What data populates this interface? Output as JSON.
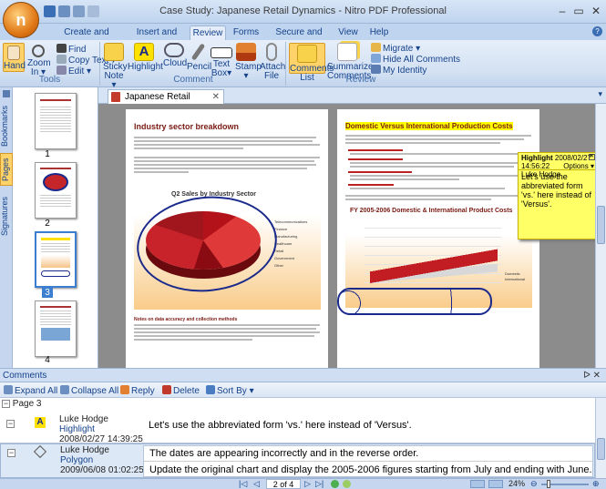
{
  "app": {
    "title": "Case Study: Japanese Retail Dynamics - Nitro PDF Professional",
    "button_letter": "n"
  },
  "window": {
    "minimize": "–",
    "maximize": "▭",
    "close": "✕"
  },
  "tabs": [
    {
      "label": "Create and Convert"
    },
    {
      "label": "Insert and Edit"
    },
    {
      "label": "Review"
    },
    {
      "label": "Forms"
    },
    {
      "label": "Secure and Sign"
    },
    {
      "label": "View"
    },
    {
      "label": "Help"
    }
  ],
  "ribbon": {
    "tools": {
      "group": "Tools",
      "hand": "Hand",
      "zoom": "Zoom",
      "zoom2": "In ▾",
      "find": "Find",
      "copy_text": "Copy Text ▾",
      "edit": "Edit ▾"
    },
    "comment": {
      "group": "Comment",
      "sticky": "Sticky",
      "sticky2": "Note ▾",
      "highlight": "Highlight",
      "cloud": "Cloud",
      "pencil": "Pencil",
      "text": "Text",
      "text2": "Box▾",
      "stamp": "Stamp",
      "stamp2": "▾",
      "attach": "Attach",
      "attach2": "File"
    },
    "review": {
      "group": "Review",
      "comments": "Comments",
      "comments2": "List",
      "summarize": "Summarize",
      "summarize2": "Comments",
      "migrate": "Migrate ▾",
      "hide_all": "Hide All Comments",
      "my_identity": "My Identity"
    }
  },
  "sidebar": {
    "bookmarks": "Bookmarks",
    "pages": "Pages",
    "signatures": "Signatures",
    "page_numbers": [
      "1",
      "2",
      "3",
      "4"
    ]
  },
  "doc_tab": {
    "label": "Japanese Retail Dynamics",
    "close": "✕"
  },
  "page_left": {
    "title": "Industry sector breakdown",
    "chart_title": "Q2 Sales by Industry Sector",
    "legend": [
      "Telecommunications",
      "Finance",
      "Manufacturing",
      "Healthcare",
      "Retail",
      "Government",
      "Other"
    ],
    "notes_title": "Notes on data accuracy and collection methods"
  },
  "page_right": {
    "title": "Domestic Versus International Production Costs",
    "chart_title": "FY 2005-2006 Domestic & International Product Costs",
    "legend": [
      "Domestic",
      "International"
    ]
  },
  "sticky_note": {
    "title": "Highlight",
    "date": "2008/02/27 14:56:22",
    "author": "Luke Hodge",
    "options": "Options ▾",
    "text": "Let's use the abbreviated form 'vs.' here instead of 'Versus'."
  },
  "comments": {
    "header": "Comments",
    "toolbar": {
      "expand_all": "Expand All",
      "collapse_all": "Collapse All",
      "reply": "Reply",
      "delete": "Delete",
      "sort_by": "Sort By ▾"
    },
    "page_group": "Page 3",
    "items": [
      {
        "author": "Luke Hodge",
        "type": "Highlight",
        "date": "2008/02/27 14:39:25",
        "text": "Let's use the abbreviated form 'vs.' here instead of 'Versus'."
      },
      {
        "author": "Luke Hodge",
        "type": "Polygon",
        "date": "2009/06/08 01:02:25",
        "text": "The dates are appearing incorrectly and in the reverse order.",
        "text2": "Update the original chart and display the 2005-2006 figures starting from July and ending with June."
      }
    ]
  },
  "statusbar": {
    "page_of": "2 of 4",
    "zoom": "24%"
  },
  "colors": {
    "accent": "#15428b",
    "highlight": "#ffff00",
    "polygon": "#1a2a8c"
  }
}
